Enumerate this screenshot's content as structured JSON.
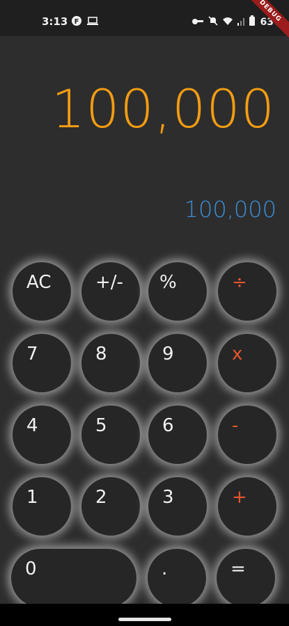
{
  "status_bar": {
    "time": "3:13",
    "battery": "63%",
    "debug_label": "DEBUG"
  },
  "display": {
    "main_value": "100,000",
    "result_value": "100,000"
  },
  "keypad": {
    "ac": "AC",
    "toggle_sign": "+/-",
    "percent": "%",
    "divide": "÷",
    "seven": "7",
    "eight": "8",
    "nine": "9",
    "multiply": "x",
    "four": "4",
    "five": "5",
    "six": "6",
    "subtract": "-",
    "one": "1",
    "two": "2",
    "three": "3",
    "add": "+",
    "zero": "0",
    "decimal": ".",
    "equals": "="
  },
  "colors": {
    "display_main": "#f39c12",
    "display_result": "#3b8fd8",
    "operator": "#e8532f",
    "button_bg": "#262626",
    "background": "#2d2d2d"
  }
}
